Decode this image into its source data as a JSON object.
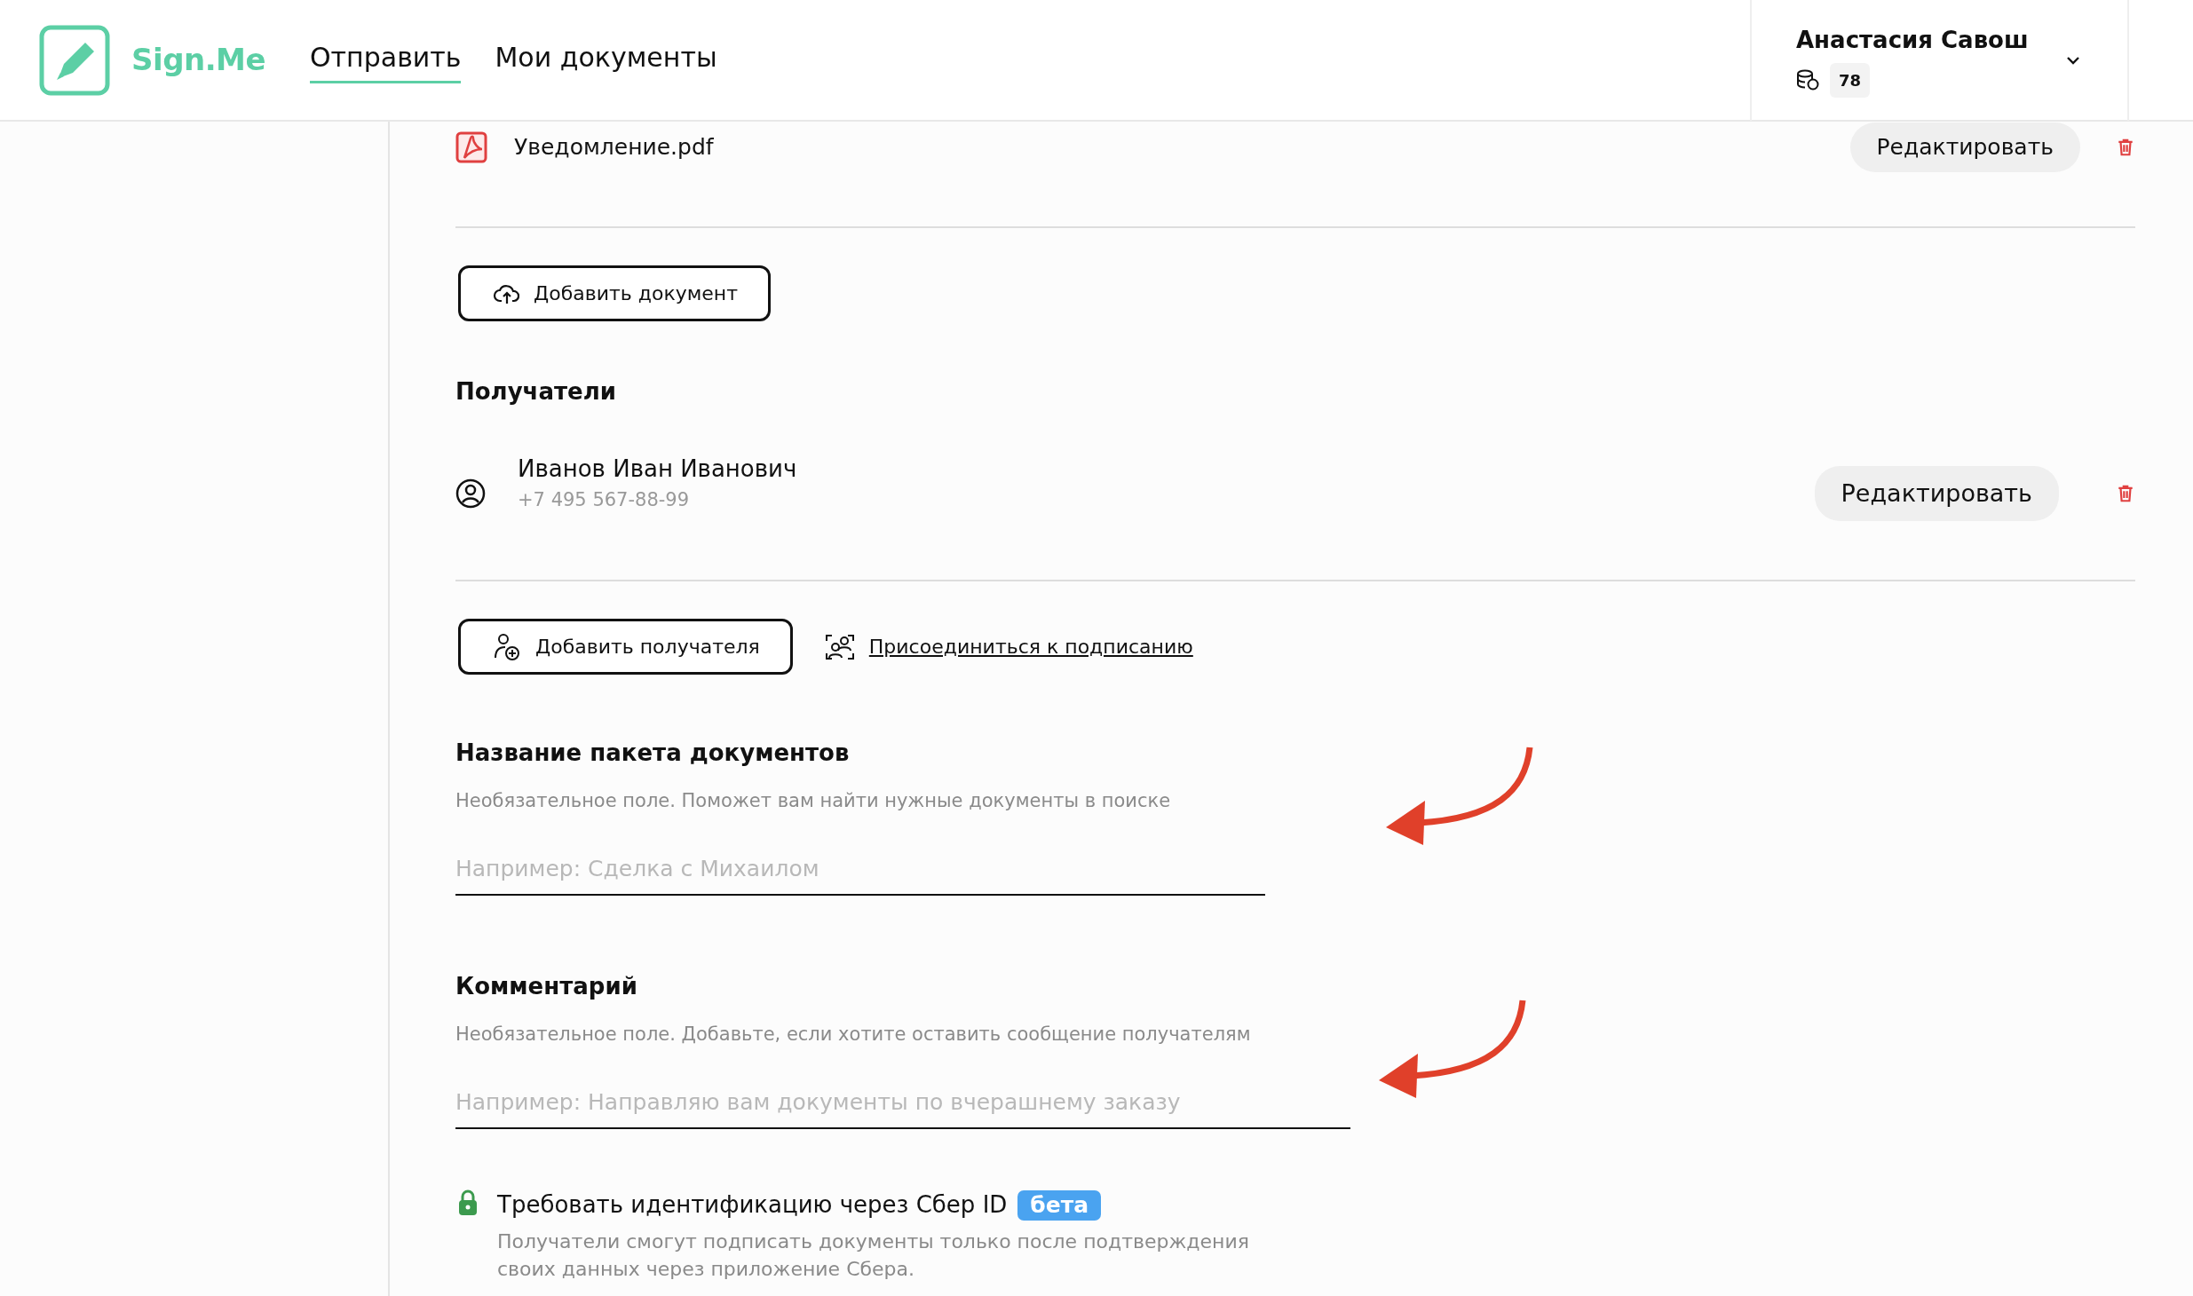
{
  "header": {
    "logo": "Sign.Me",
    "nav": [
      {
        "label": "Отправить",
        "selected": true
      },
      {
        "label": "Мои документы",
        "selected": false
      }
    ],
    "user": {
      "name": "Анастасия Савош",
      "balance": "78"
    }
  },
  "documents": [
    {
      "name": "Уведомление.pdf",
      "edit": "Редактировать"
    }
  ],
  "add_document": "Добавить документ",
  "recipients": {
    "title": "Получатели",
    "items": [
      {
        "name": "Иванов Иван Иванович",
        "phone": "+7 495 567-88-99",
        "edit": "Редактировать"
      }
    ]
  },
  "add_recipient": "Добавить получателя",
  "join_link": "Присоединиться к подписанию",
  "fields": [
    {
      "label": "Название пакета документов",
      "hint": "Необязательное поле. Поможет вам найти нужные документы в поиске",
      "placeholder": "Например: Сделка с Михаилом"
    },
    {
      "label": "Комментарий",
      "hint": "Необязательное поле. Добавьте, если хотите оставить сообщение получателям",
      "placeholder": "Например: Направляю вам документы по вчерашнему заказу"
    }
  ],
  "sber": {
    "title": "Требовать идентификацию через Сбер ID",
    "badge": "бета",
    "description": "Получатели смогут подписать документы только после подтверждения своих данных через приложение Сбера."
  }
}
